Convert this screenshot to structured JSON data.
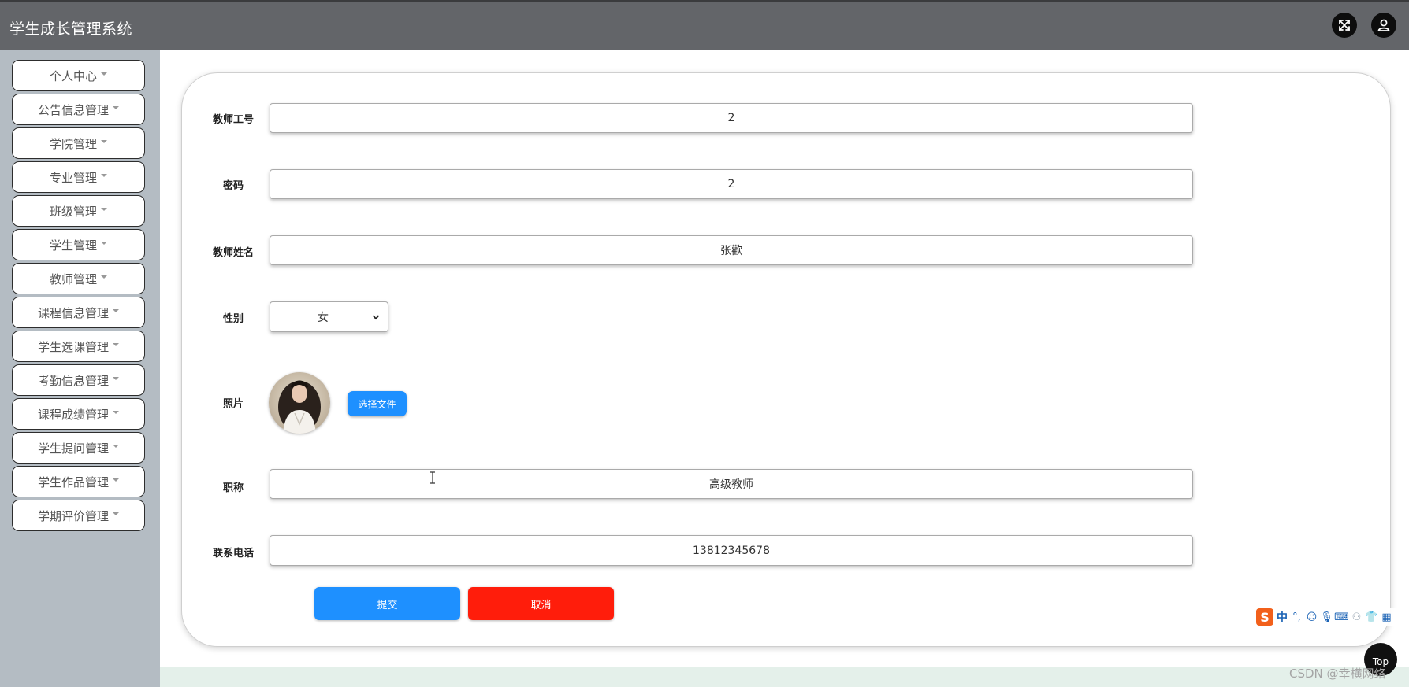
{
  "header": {
    "title": "学生成长管理系统",
    "icons": [
      "fullscreen-icon",
      "user-icon"
    ]
  },
  "sidebar": {
    "items": [
      {
        "label": "个人中心"
      },
      {
        "label": "公告信息管理"
      },
      {
        "label": "学院管理"
      },
      {
        "label": "专业管理"
      },
      {
        "label": "班级管理"
      },
      {
        "label": "学生管理"
      },
      {
        "label": "教师管理"
      },
      {
        "label": "课程信息管理"
      },
      {
        "label": "学生选课管理"
      },
      {
        "label": "考勤信息管理"
      },
      {
        "label": "课程成绩管理"
      },
      {
        "label": "学生提问管理"
      },
      {
        "label": "学生作品管理"
      },
      {
        "label": "学期评价管理"
      }
    ]
  },
  "form": {
    "teacher_id": {
      "label": "教师工号",
      "value": "2"
    },
    "password": {
      "label": "密码",
      "value": "2"
    },
    "teacher_name": {
      "label": "教师姓名",
      "value": "张歡"
    },
    "gender": {
      "label": "性别",
      "value": "女"
    },
    "photo": {
      "label": "照片",
      "upload_label": "选择文件"
    },
    "title": {
      "label": "职称",
      "value": "高级教师"
    },
    "phone": {
      "label": "联系电话",
      "value": "13812345678"
    },
    "submit_label": "提交",
    "cancel_label": "取消"
  },
  "ime": {
    "lang": "中",
    "logo": "S"
  },
  "scroll_top_label": "Top",
  "watermark": "CSDN @幸横网络",
  "colors": {
    "header_bg": "#636569",
    "sidebar_bg": "#b4bcc3",
    "primary": "#1e90ff",
    "danger": "#ff1d0b"
  }
}
